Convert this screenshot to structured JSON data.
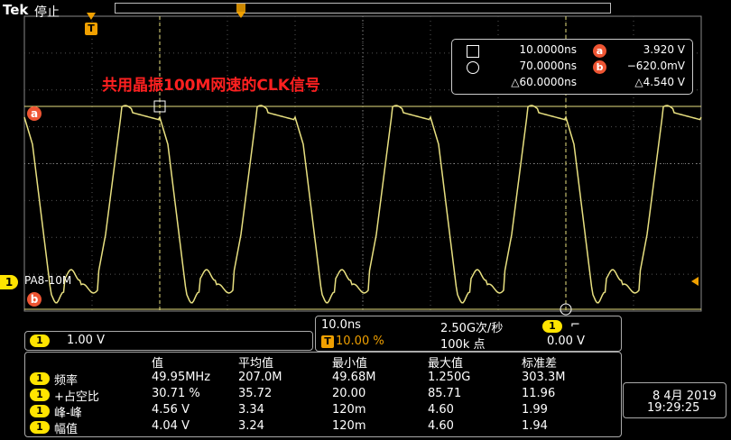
{
  "header": {
    "brand": "Tek",
    "state": "停止"
  },
  "trigger": {
    "marker_label": "T",
    "position_label": "T"
  },
  "cursor_readout": {
    "rows": [
      {
        "symbol": "square-icon",
        "time": "10.0000ns",
        "badge": "a",
        "value": "3.920 V"
      },
      {
        "symbol": "circle-icon",
        "time": "70.0000ns",
        "badge": "b",
        "value": "−620.0mV"
      },
      {
        "symbol": "",
        "time": "△60.0000ns",
        "badge": "",
        "value": "△4.540 V"
      }
    ]
  },
  "annotation": "共用晶振100M网速的CLK信号",
  "channel": {
    "number": "1",
    "label": "PA8-10M",
    "scale": "1.00 V"
  },
  "cursor_badges": {
    "a": "a",
    "b": "b"
  },
  "horizontal": {
    "timebase": "10.0ns",
    "sample_rate": "2.50G次/秒",
    "trigger_pos": "10.00 %",
    "record_length": "100k 点",
    "trigger_source": "1",
    "trigger_slope": "⌐",
    "trigger_level": "0.00 V"
  },
  "measurements": {
    "headers": [
      "值",
      "平均值",
      "最小值",
      "最大值",
      "标准差"
    ],
    "rows": [
      {
        "ch": "1",
        "name": "频率",
        "values": [
          "49.95MHz",
          "207.0M",
          "49.68M",
          "1.250G",
          "303.3M"
        ]
      },
      {
        "ch": "1",
        "name": "+占空比",
        "values": [
          "30.71 %",
          "35.72",
          "20.00",
          "85.71",
          "11.96"
        ]
      },
      {
        "ch": "1",
        "name": "峰-峰",
        "values": [
          "4.56 V",
          "3.34",
          "120m",
          "4.60",
          "1.99"
        ]
      },
      {
        "ch": "1",
        "name": "幅值",
        "values": [
          "4.04 V",
          "3.24",
          "120m",
          "4.60",
          "1.94"
        ]
      }
    ]
  },
  "datetime": {
    "date": "8 4月 2019",
    "time": "19:29:25"
  },
  "colors": {
    "trace": "#e8e080",
    "channel": "#ffe400",
    "trigger": "#f0a000",
    "cursor": "#e53c30",
    "annotation": "#ff2020"
  }
}
